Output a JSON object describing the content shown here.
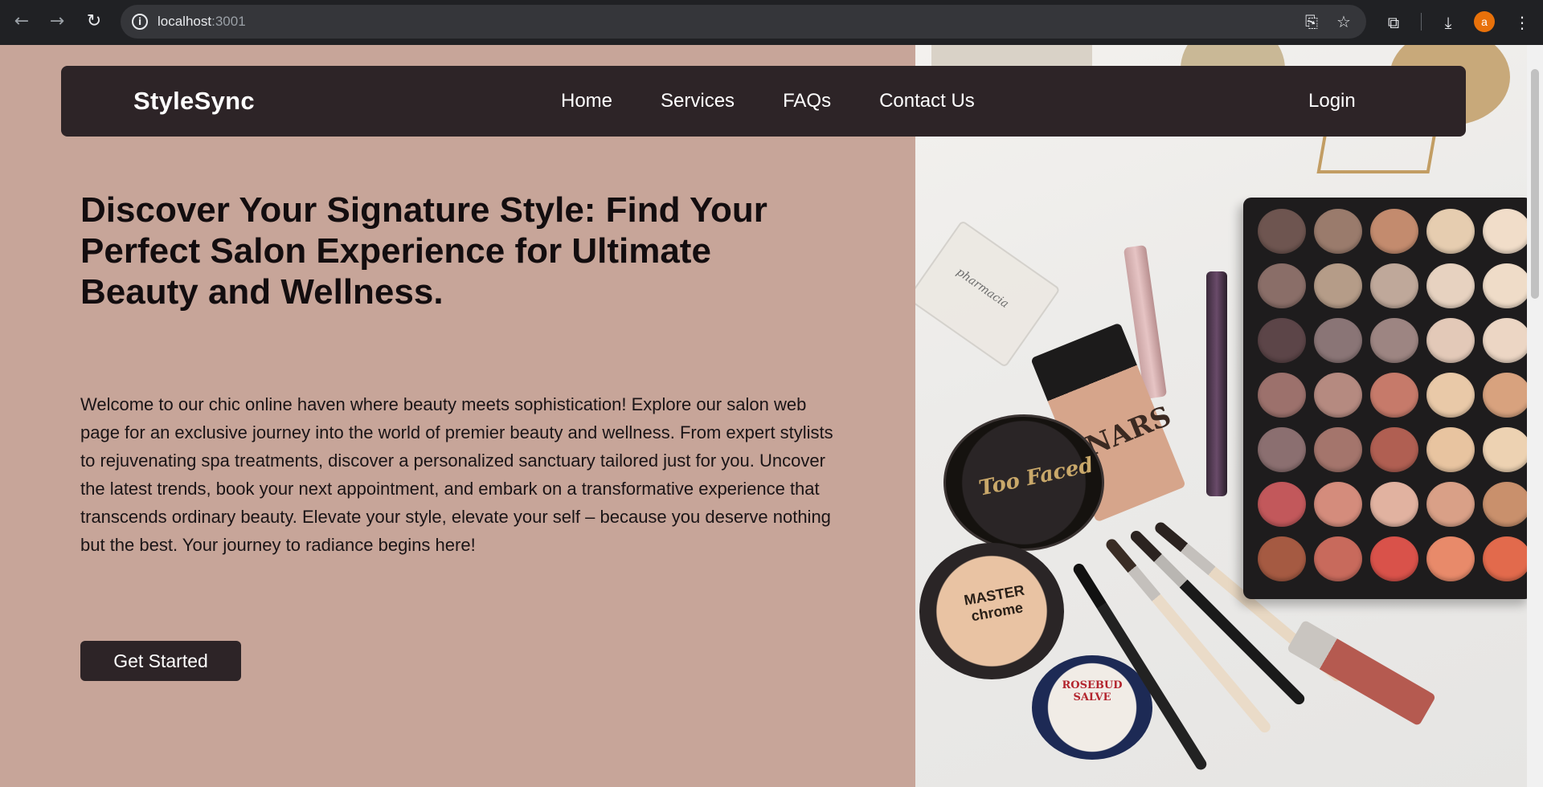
{
  "browser": {
    "url_host": "localhost",
    "url_port": ":3001",
    "avatar_initial": "a"
  },
  "nav": {
    "brand": "StyleSync",
    "links": [
      "Home",
      "Services",
      "FAQs",
      "Contact Us"
    ],
    "login": "Login"
  },
  "hero": {
    "headline": "Discover Your Signature Style: Find Your Perfect Salon Experience for Ultimate Beauty and Wellness.",
    "intro": "Welcome to our chic online haven where beauty meets sophistication! Explore our salon web page for an exclusive journey into the world of premier beauty and wellness. From expert stylists to rejuvenating spa treatments, discover a personalized sanctuary tailored just for you. Uncover the latest trends, book your next appointment, and embark on a transformative experience that transcends ordinary beauty. Elevate your style, elevate your self – because you deserve nothing but the best. Your journey to radiance begins here!",
    "cta": "Get Started"
  },
  "hero_image": {
    "labels": {
      "jar1": "Too Faced",
      "jar2": "MASTER chrome",
      "jar3": "ROSEBUD SALVE",
      "bottle": "NARS",
      "perfume": "pharmacia"
    }
  },
  "colors": {
    "page_bg": "#c7a599",
    "navbar_bg": "#2d2427",
    "button_bg": "#2d2427",
    "text_dark": "#130d0f"
  }
}
